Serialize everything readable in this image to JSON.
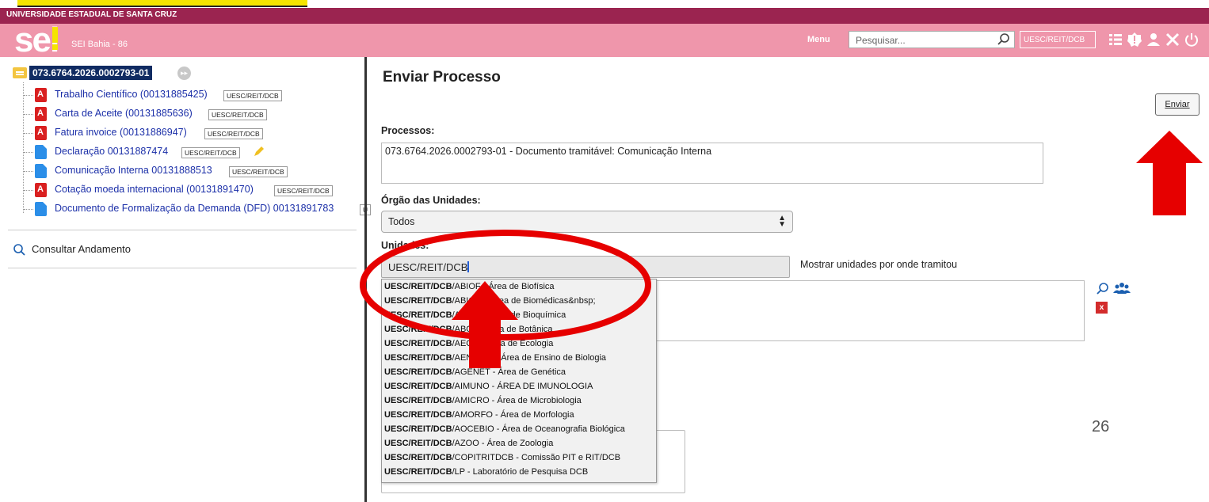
{
  "header": {
    "university": "UNIVERSIDADE ESTADUAL DE SANTA CRUZ",
    "logo_text": "sei",
    "org_label": "SEI Bahia - 86",
    "menu_label": "Menu",
    "search_placeholder": "Pesquisar...",
    "unit_label": "UESC/REIT/DCB",
    "icons": [
      "search-icon",
      "grid-menu-icon",
      "alert-badge-icon",
      "user-icon",
      "tools-icon",
      "power-icon"
    ]
  },
  "tree": {
    "process_number": "073.6764.2026.0002793-01",
    "documents": [
      {
        "icon": "pdf-icon",
        "label": "Trabalho Científico (00131885425)",
        "tag": "UESC/REIT/DCB"
      },
      {
        "icon": "pdf-icon",
        "label": "Carta de Aceite (00131885636)",
        "tag": "UESC/REIT/DCB"
      },
      {
        "icon": "pdf-icon",
        "label": "Fatura invoice (00131886947)",
        "tag": "UESC/REIT/DCB"
      },
      {
        "icon": "doc-icon",
        "label": "Declaração 00131887474",
        "tag": "UESC/REIT/DCB"
      },
      {
        "icon": "doc-icon",
        "label": "Comunicação Interna 00131888513",
        "tag": "UESC/REIT/DCB"
      },
      {
        "icon": "pdf-icon",
        "label": "Cotação moeda internacional (00131891470)",
        "tag": "UESC/REIT/DCB"
      },
      {
        "icon": "doc-icon",
        "label": "Documento de Formalização da Demanda (DFD) 00131891783",
        "tag": "U"
      }
    ],
    "consultar_label": "Consultar Andamento"
  },
  "main": {
    "title": "Enviar Processo",
    "enviar_label": "Enviar",
    "processos_label": "Processos:",
    "processos_value": "073.6764.2026.0002793-01 - Documento tramitável: Comunicação Interna",
    "orgao_label": "Órgão das Unidades:",
    "orgao_value": "Todos",
    "unidades_label": "Unidades:",
    "unidade_input_value": "UESC/REIT/DCB",
    "mostrar_label": "Mostrar unidades por onde tramitou",
    "remove_icon_text": "x"
  },
  "dropdown": {
    "items": [
      {
        "bold": "UESC/REIT/DCB",
        "rest": "/ABIOF - Área de Biofísica"
      },
      {
        "bold": "UESC/REIT/DCB",
        "rest": "/ABIOM - Área de Biomédicas&nbsp;"
      },
      {
        "bold": "UESC/REIT/DCB",
        "rest": "/ABIOQ - Área de Bioquímica"
      },
      {
        "bold": "UESC/REIT/DCB",
        "rest": "/ABOT - Área de Botânica"
      },
      {
        "bold": "UESC/REIT/DCB",
        "rest": "/AECO - Área de Ecologia"
      },
      {
        "bold": "UESC/REIT/DCB",
        "rest": "/AENSBIO - Área de Ensino de Biologia"
      },
      {
        "bold": "UESC/REIT/DCB",
        "rest": "/AGENET - Área de Genética"
      },
      {
        "bold": "UESC/REIT/DCB",
        "rest": "/AIMUNO - ÁREA DE IMUNOLOGIA"
      },
      {
        "bold": "UESC/REIT/DCB",
        "rest": "/AMICRO - Área de Microbiologia"
      },
      {
        "bold": "UESC/REIT/DCB",
        "rest": "/AMORFO - Área de Morfologia"
      },
      {
        "bold": "UESC/REIT/DCB",
        "rest": "/AOCEBIO - Área de Oceanografia Biológica"
      },
      {
        "bold": "UESC/REIT/DCB",
        "rest": "/AZOO - Área de Zoologia"
      },
      {
        "bold": "UESC/REIT/DCB",
        "rest": "/COPITRITDCB - Comissão PIT e RIT/DCB"
      },
      {
        "bold": "UESC/REIT/DCB",
        "rest": "/LP - Laboratório de Pesquisa DCB"
      }
    ]
  },
  "slide": {
    "page_number": "26"
  },
  "colors": {
    "top_bar": "#9b2450",
    "header": "#ef96ab",
    "process_badge": "#102b62",
    "link": "#1b2fa8",
    "annotation_red": "#e60000"
  }
}
